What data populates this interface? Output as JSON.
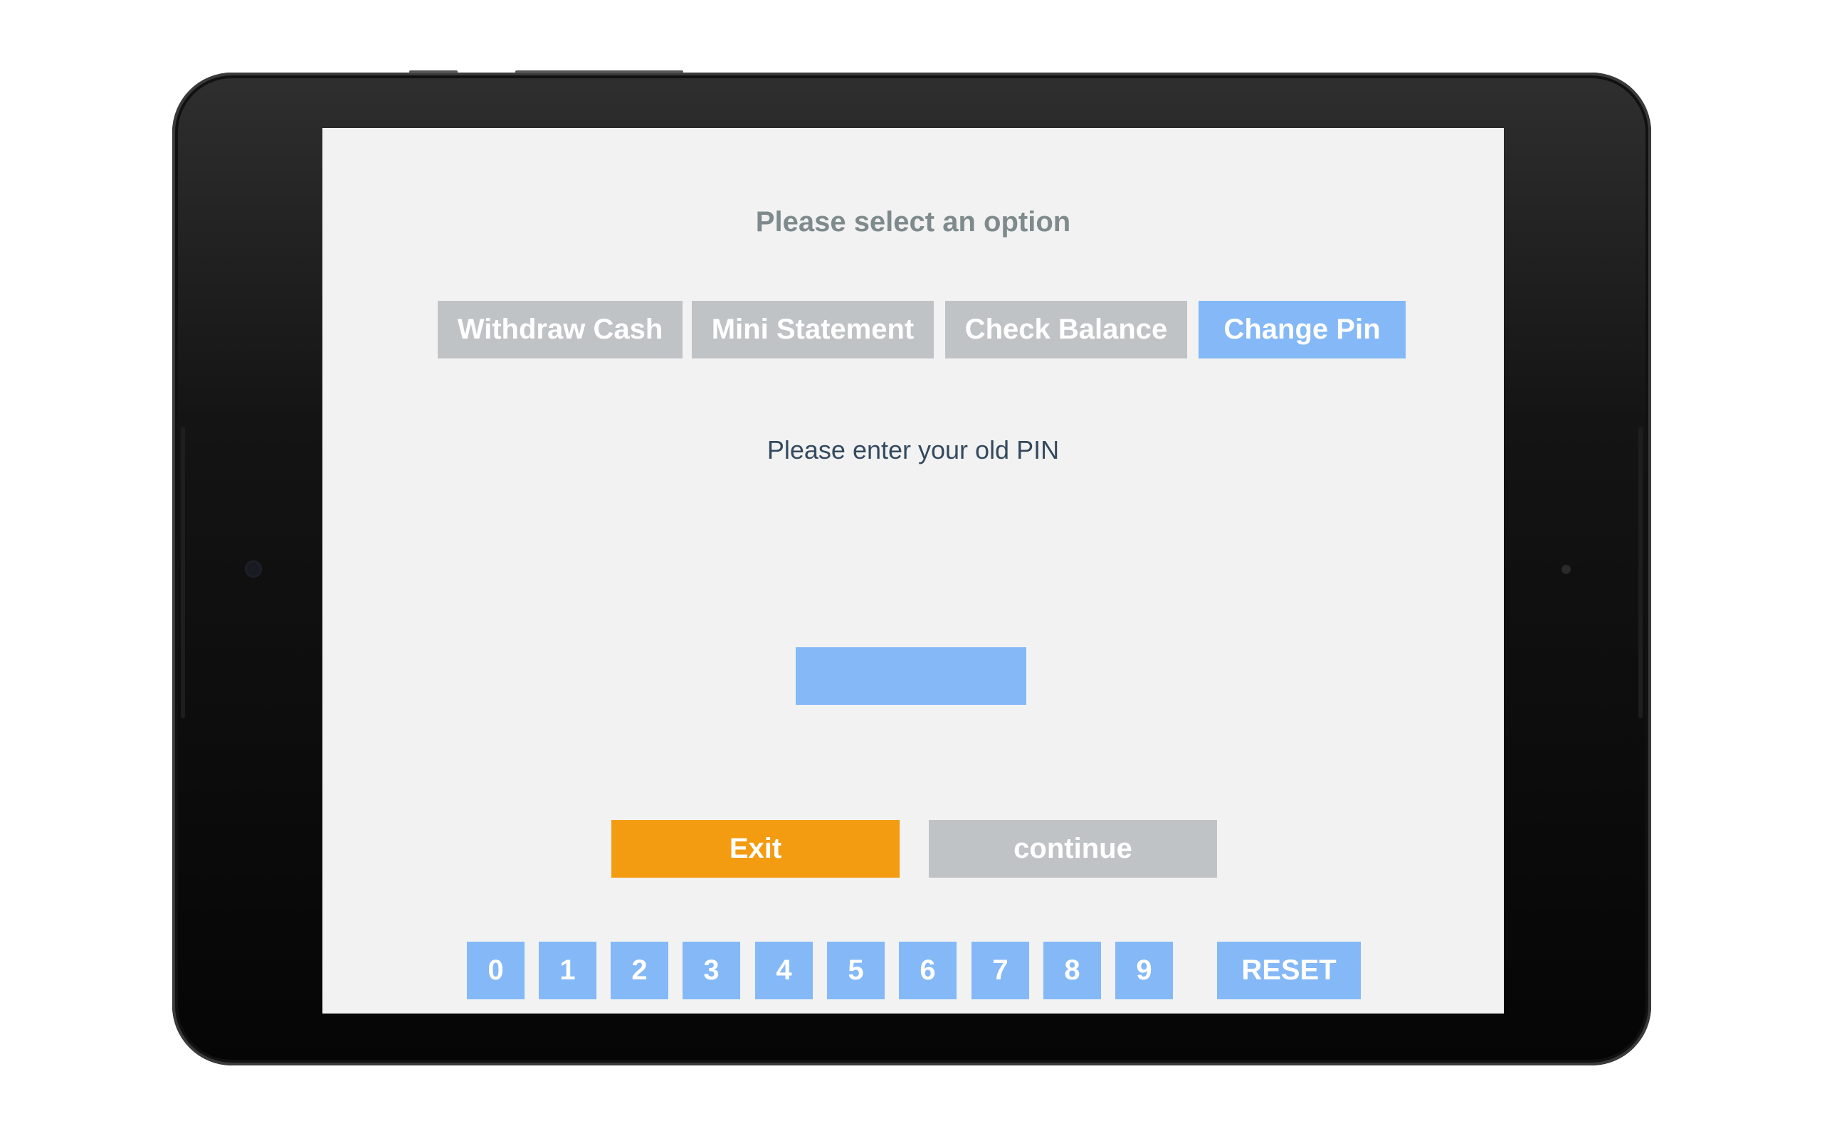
{
  "screen": {
    "heading": "Please select an option",
    "tabs": [
      {
        "label": "Withdraw Cash",
        "active": false
      },
      {
        "label": "Mini Statement",
        "active": false
      },
      {
        "label": "Check Balance",
        "active": false
      },
      {
        "label": "Change Pin",
        "active": true
      }
    ],
    "prompt": "Please enter your old PIN",
    "pin_input": {
      "value": "",
      "placeholder": ""
    },
    "actions": {
      "exit_label": "Exit",
      "continue_label": "continue"
    },
    "keypad": {
      "digits": [
        "0",
        "1",
        "2",
        "3",
        "4",
        "5",
        "6",
        "7",
        "8",
        "9"
      ],
      "reset_label": "RESET"
    }
  },
  "colors": {
    "active_blue": "#84b8f7",
    "inactive_gray": "#bfc3c6",
    "exit_orange": "#f39c12",
    "heading_gray": "#7e8a8c",
    "prompt_navy": "#34495e",
    "screen_bg": "#f2f2f2"
  },
  "icons": {
    "camera": "front-camera-icon",
    "sensor": "light-sensor-icon"
  }
}
